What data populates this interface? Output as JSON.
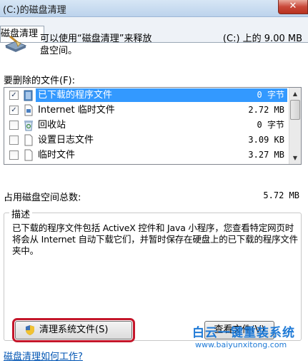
{
  "window": {
    "title": "(C:)的磁盘清理",
    "close_glyph": "✕"
  },
  "tab": {
    "label": "磁盘清理"
  },
  "header": {
    "line1_lead": "可以使用“磁盘清理”来释放",
    "line1_tail": "(C:) 上的 9.00 MB",
    "line2": "盘空间。",
    "icon": "disk-cleanup-icon"
  },
  "files_label": "要删除的文件(F):",
  "files": [
    {
      "checked": true,
      "name": "已下载的程序文件",
      "size": "0 字节",
      "icon": "folder-icon",
      "selected": true
    },
    {
      "checked": true,
      "name": "Internet 临时文件",
      "size": "2.72 MB",
      "icon": "document-icon",
      "selected": false
    },
    {
      "checked": false,
      "name": "回收站",
      "size": "0 字节",
      "icon": "recycle-bin-icon",
      "selected": false
    },
    {
      "checked": false,
      "name": "设置日志文件",
      "size": "3.09 KB",
      "icon": "document-icon",
      "selected": false
    },
    {
      "checked": false,
      "name": "临时文件",
      "size": "3.27 MB",
      "icon": "document-icon",
      "selected": false
    }
  ],
  "total": {
    "label": "占用磁盘空间总数:",
    "value": "5.72 MB"
  },
  "description": {
    "caption": "描述",
    "text": "已下载的程序文件包括 ActiveX 控件和 Java 小程序，您查看特定网页时将会从 Internet 自动下载它们，并暂时保存在硬盘上的已下载的程序文件夹中。"
  },
  "buttons": {
    "clean_system": "清理系统文件(S)",
    "view_files": "查看文件(V)"
  },
  "help_link": "磁盘清理如何工作?",
  "watermark": {
    "line1": "白云一键重装系统",
    "line2": "www.baiyunxitong.com"
  },
  "colors": {
    "selection": "#3399ff",
    "highlight_border": "#c4162a",
    "link": "#0054b3",
    "watermark": "#1f7ad6"
  }
}
